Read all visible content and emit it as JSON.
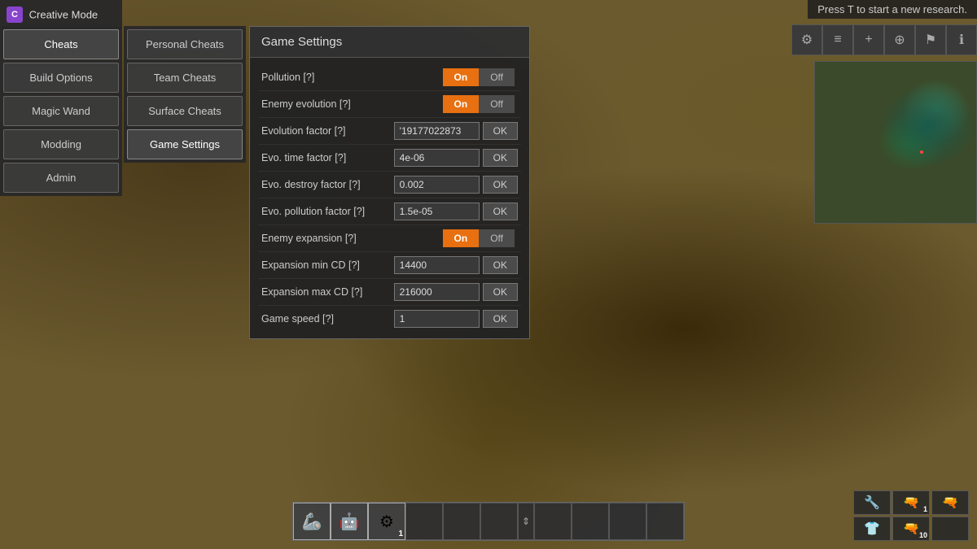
{
  "notification": {
    "text": "Press T to start a new research."
  },
  "creative_mode": {
    "label": "Creative Mode",
    "icon": "C"
  },
  "left_sidebar": {
    "items": [
      {
        "id": "cheats",
        "label": "Cheats",
        "active": true
      },
      {
        "id": "build-options",
        "label": "Build Options",
        "active": false
      },
      {
        "id": "magic-wand",
        "label": "Magic Wand",
        "active": false
      },
      {
        "id": "modding",
        "label": "Modding",
        "active": false
      },
      {
        "id": "admin",
        "label": "Admin",
        "active": false
      }
    ]
  },
  "cheats_submenu": {
    "items": [
      {
        "id": "personal-cheats",
        "label": "Personal Cheats",
        "active": false
      },
      {
        "id": "team-cheats",
        "label": "Team Cheats",
        "active": false
      },
      {
        "id": "surface-cheats",
        "label": "Surface Cheats",
        "active": false
      },
      {
        "id": "game-settings",
        "label": "Game Settings",
        "active": true
      }
    ]
  },
  "game_settings": {
    "title": "Game Settings",
    "rows": [
      {
        "id": "pollution",
        "label": "Pollution [?]",
        "type": "toggle",
        "value": "on"
      },
      {
        "id": "enemy-evolution",
        "label": "Enemy evolution [?]",
        "type": "toggle",
        "value": "on"
      },
      {
        "id": "evolution-factor",
        "label": "Evolution factor [?]",
        "type": "input",
        "value": "'19177022873"
      },
      {
        "id": "evo-time-factor",
        "label": "Evo. time factor [?]",
        "type": "input",
        "value": "4e-06"
      },
      {
        "id": "evo-destroy-factor",
        "label": "Evo. destroy factor [?]",
        "type": "input",
        "value": "0.002"
      },
      {
        "id": "evo-pollution-factor",
        "label": "Evo. pollution factor [?]",
        "type": "input",
        "value": "1.5e-05"
      },
      {
        "id": "enemy-expansion",
        "label": "Enemy expansion [?]",
        "type": "toggle",
        "value": "on"
      },
      {
        "id": "expansion-min-cd",
        "label": "Expansion min CD [?]",
        "type": "input",
        "value": "14400"
      },
      {
        "id": "expansion-max-cd",
        "label": "Expansion max CD [?]",
        "type": "input",
        "value": "216000"
      },
      {
        "id": "game-speed",
        "label": "Game speed [?]",
        "type": "input",
        "value": "1"
      }
    ],
    "toggle_on_label": "On",
    "toggle_off_label": "Off",
    "ok_label": "OK"
  },
  "toolbar": {
    "buttons": [
      {
        "id": "settings",
        "icon": "⚙"
      },
      {
        "id": "list",
        "icon": "≡"
      },
      {
        "id": "plus",
        "icon": "+"
      },
      {
        "id": "map",
        "icon": "⊕"
      },
      {
        "id": "factory",
        "icon": "⚑"
      },
      {
        "id": "info",
        "icon": "ℹ"
      }
    ]
  },
  "hotbar": {
    "slots": [
      {
        "id": 1,
        "has_item": true,
        "icon": "🦾",
        "count": ""
      },
      {
        "id": 2,
        "has_item": true,
        "icon": "🤖",
        "count": ""
      },
      {
        "id": 3,
        "has_item": true,
        "icon": "⚙",
        "count": "1"
      },
      {
        "id": 4,
        "has_item": false,
        "icon": "",
        "count": ""
      },
      {
        "id": 5,
        "has_item": false,
        "icon": "",
        "count": ""
      },
      {
        "id": 6,
        "has_item": false,
        "icon": "",
        "count": ""
      },
      {
        "id": 7,
        "has_item": false,
        "icon": "",
        "count": ""
      },
      {
        "id": 8,
        "has_item": false,
        "icon": "",
        "count": ""
      },
      {
        "id": 9,
        "has_item": false,
        "icon": "",
        "count": ""
      },
      {
        "id": 10,
        "has_item": false,
        "icon": "",
        "count": ""
      }
    ],
    "arrow_icon": "⇕"
  },
  "weapons": {
    "row1": [
      {
        "id": "weapon1",
        "icon": "🔧",
        "count": ""
      },
      {
        "id": "weapon2",
        "icon": "🔫",
        "count": "1"
      },
      {
        "id": "weapon3",
        "icon": "🔫",
        "count": ""
      }
    ],
    "row2": [
      {
        "id": "armor",
        "icon": "👕",
        "count": ""
      },
      {
        "id": "ammo",
        "icon": "🔫",
        "count": "10"
      },
      {
        "id": "extra",
        "icon": "",
        "count": ""
      }
    ]
  }
}
